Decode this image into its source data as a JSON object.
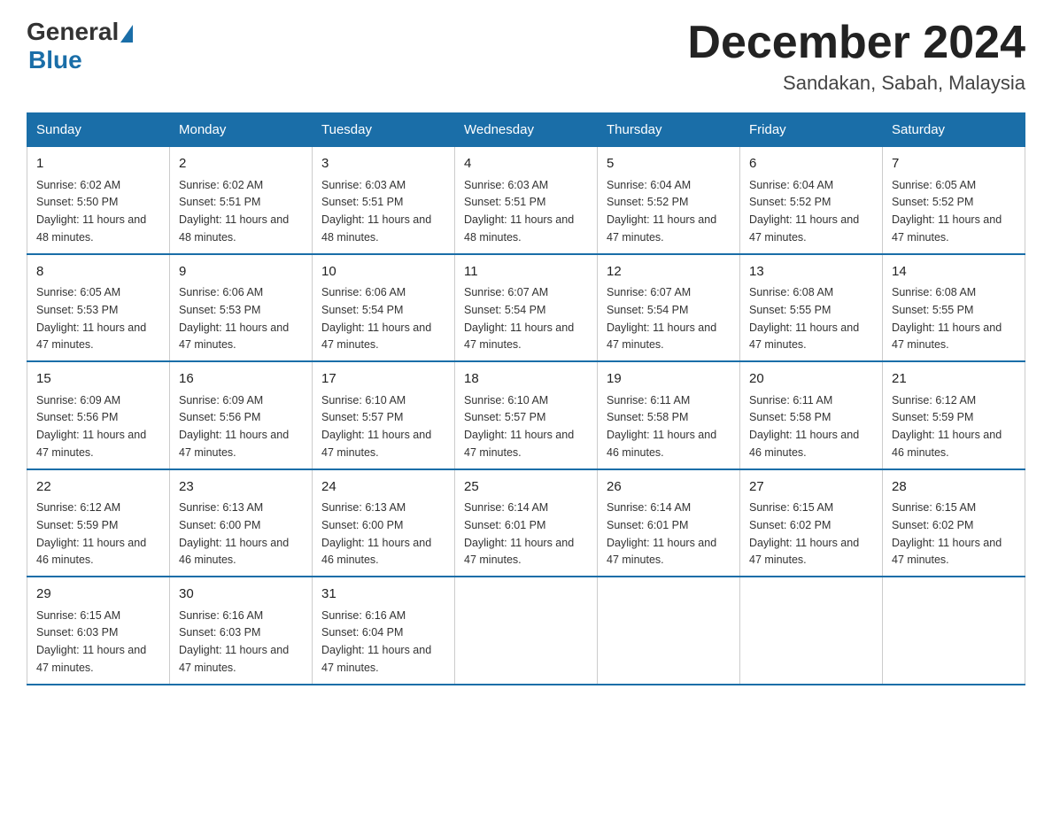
{
  "logo": {
    "general": "General",
    "blue": "Blue"
  },
  "title": "December 2024",
  "subtitle": "Sandakan, Sabah, Malaysia",
  "days": [
    "Sunday",
    "Monday",
    "Tuesday",
    "Wednesday",
    "Thursday",
    "Friday",
    "Saturday"
  ],
  "weeks": [
    [
      {
        "num": "1",
        "sunrise": "6:02 AM",
        "sunset": "5:50 PM",
        "daylight": "11 hours and 48 minutes."
      },
      {
        "num": "2",
        "sunrise": "6:02 AM",
        "sunset": "5:51 PM",
        "daylight": "11 hours and 48 minutes."
      },
      {
        "num": "3",
        "sunrise": "6:03 AM",
        "sunset": "5:51 PM",
        "daylight": "11 hours and 48 minutes."
      },
      {
        "num": "4",
        "sunrise": "6:03 AM",
        "sunset": "5:51 PM",
        "daylight": "11 hours and 48 minutes."
      },
      {
        "num": "5",
        "sunrise": "6:04 AM",
        "sunset": "5:52 PM",
        "daylight": "11 hours and 47 minutes."
      },
      {
        "num": "6",
        "sunrise": "6:04 AM",
        "sunset": "5:52 PM",
        "daylight": "11 hours and 47 minutes."
      },
      {
        "num": "7",
        "sunrise": "6:05 AM",
        "sunset": "5:52 PM",
        "daylight": "11 hours and 47 minutes."
      }
    ],
    [
      {
        "num": "8",
        "sunrise": "6:05 AM",
        "sunset": "5:53 PM",
        "daylight": "11 hours and 47 minutes."
      },
      {
        "num": "9",
        "sunrise": "6:06 AM",
        "sunset": "5:53 PM",
        "daylight": "11 hours and 47 minutes."
      },
      {
        "num": "10",
        "sunrise": "6:06 AM",
        "sunset": "5:54 PM",
        "daylight": "11 hours and 47 minutes."
      },
      {
        "num": "11",
        "sunrise": "6:07 AM",
        "sunset": "5:54 PM",
        "daylight": "11 hours and 47 minutes."
      },
      {
        "num": "12",
        "sunrise": "6:07 AM",
        "sunset": "5:54 PM",
        "daylight": "11 hours and 47 minutes."
      },
      {
        "num": "13",
        "sunrise": "6:08 AM",
        "sunset": "5:55 PM",
        "daylight": "11 hours and 47 minutes."
      },
      {
        "num": "14",
        "sunrise": "6:08 AM",
        "sunset": "5:55 PM",
        "daylight": "11 hours and 47 minutes."
      }
    ],
    [
      {
        "num": "15",
        "sunrise": "6:09 AM",
        "sunset": "5:56 PM",
        "daylight": "11 hours and 47 minutes."
      },
      {
        "num": "16",
        "sunrise": "6:09 AM",
        "sunset": "5:56 PM",
        "daylight": "11 hours and 47 minutes."
      },
      {
        "num": "17",
        "sunrise": "6:10 AM",
        "sunset": "5:57 PM",
        "daylight": "11 hours and 47 minutes."
      },
      {
        "num": "18",
        "sunrise": "6:10 AM",
        "sunset": "5:57 PM",
        "daylight": "11 hours and 47 minutes."
      },
      {
        "num": "19",
        "sunrise": "6:11 AM",
        "sunset": "5:58 PM",
        "daylight": "11 hours and 46 minutes."
      },
      {
        "num": "20",
        "sunrise": "6:11 AM",
        "sunset": "5:58 PM",
        "daylight": "11 hours and 46 minutes."
      },
      {
        "num": "21",
        "sunrise": "6:12 AM",
        "sunset": "5:59 PM",
        "daylight": "11 hours and 46 minutes."
      }
    ],
    [
      {
        "num": "22",
        "sunrise": "6:12 AM",
        "sunset": "5:59 PM",
        "daylight": "11 hours and 46 minutes."
      },
      {
        "num": "23",
        "sunrise": "6:13 AM",
        "sunset": "6:00 PM",
        "daylight": "11 hours and 46 minutes."
      },
      {
        "num": "24",
        "sunrise": "6:13 AM",
        "sunset": "6:00 PM",
        "daylight": "11 hours and 46 minutes."
      },
      {
        "num": "25",
        "sunrise": "6:14 AM",
        "sunset": "6:01 PM",
        "daylight": "11 hours and 47 minutes."
      },
      {
        "num": "26",
        "sunrise": "6:14 AM",
        "sunset": "6:01 PM",
        "daylight": "11 hours and 47 minutes."
      },
      {
        "num": "27",
        "sunrise": "6:15 AM",
        "sunset": "6:02 PM",
        "daylight": "11 hours and 47 minutes."
      },
      {
        "num": "28",
        "sunrise": "6:15 AM",
        "sunset": "6:02 PM",
        "daylight": "11 hours and 47 minutes."
      }
    ],
    [
      {
        "num": "29",
        "sunrise": "6:15 AM",
        "sunset": "6:03 PM",
        "daylight": "11 hours and 47 minutes."
      },
      {
        "num": "30",
        "sunrise": "6:16 AM",
        "sunset": "6:03 PM",
        "daylight": "11 hours and 47 minutes."
      },
      {
        "num": "31",
        "sunrise": "6:16 AM",
        "sunset": "6:04 PM",
        "daylight": "11 hours and 47 minutes."
      },
      null,
      null,
      null,
      null
    ]
  ]
}
